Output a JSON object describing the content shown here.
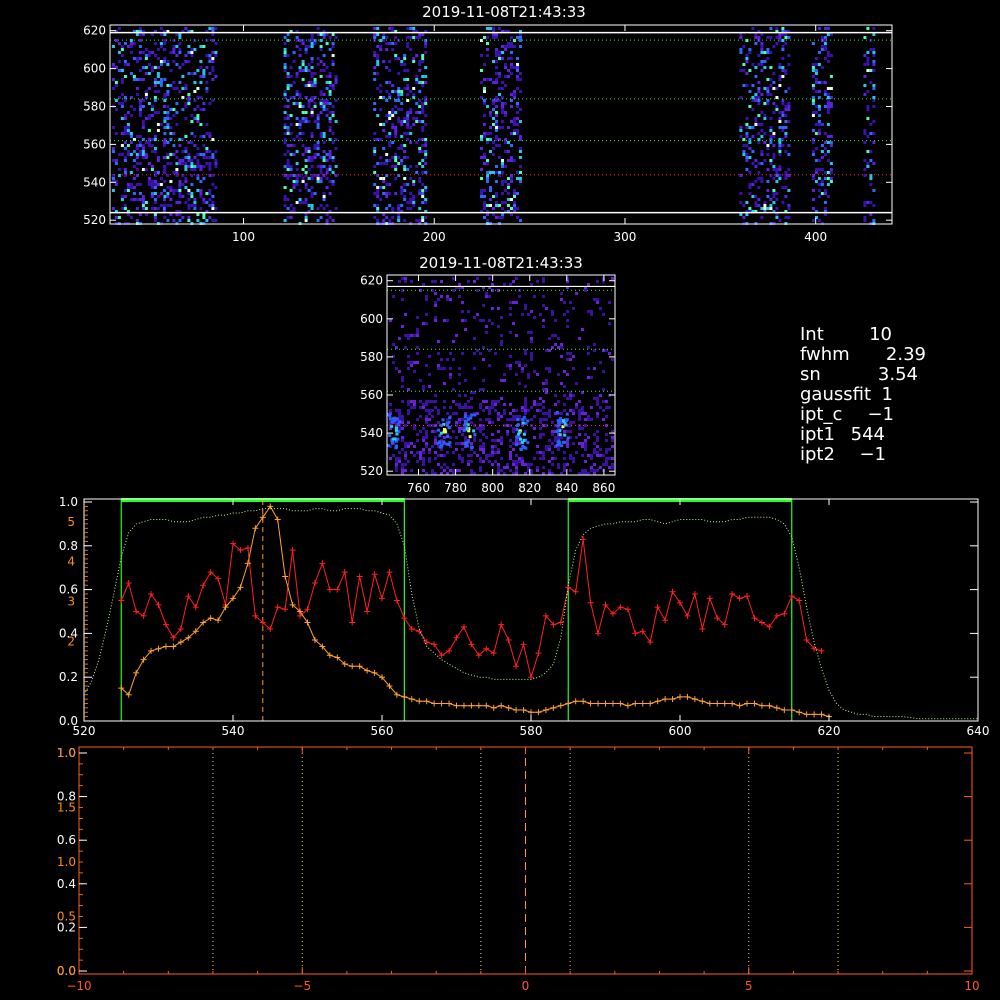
{
  "colors": {
    "background": "#000000",
    "axes_white": "#ffffff",
    "axes_orange": "#ff8c1a",
    "axes_red": "#ff2a2a",
    "green": "#22ff22",
    "dotted_green": "#b8ff9a",
    "dotted_gray": "#cfcfcf",
    "red_series": "#ff2020",
    "orange_series": "#ffa030",
    "orange_dash": "#ff9a2a",
    "orange_dotted": "#e8e070"
  },
  "info": {
    "int_label": "Int",
    "int_value": "10",
    "fwhm_label": "fwhm",
    "fwhm_value": "2.39",
    "sn_label": "sn",
    "sn_value": "3.54",
    "gaussfit_label": "gaussfit",
    "gaussfit_value": "1",
    "iptc_label": "ipt_c",
    "iptc_value": "−1",
    "ipt1_label": "ipt1",
    "ipt1_value": "544",
    "ipt2_label": "ipt2",
    "ipt2_value": "−1"
  },
  "chart_data": [
    {
      "type": "heatmap",
      "title": "2019-11-08T21:43:33",
      "xlim": [
        30,
        440
      ],
      "ylim": [
        518,
        623
      ],
      "xticks": [
        "100",
        "200",
        "300",
        "400"
      ],
      "xtick_values": [
        100,
        200,
        300,
        400
      ],
      "yticks": [
        "520",
        "540",
        "560",
        "580",
        "600",
        "620"
      ],
      "ytick_values": [
        520,
        540,
        560,
        580,
        600,
        620
      ],
      "white_lines_y": [
        524,
        619
      ],
      "green_dotted_y": [
        615,
        584,
        562
      ],
      "red_dotted_y": [
        544
      ],
      "bands_x": [
        [
          31,
          58
        ],
        [
          58,
          86
        ],
        [
          121,
          148
        ],
        [
          168,
          196
        ],
        [
          224,
          245
        ],
        [
          360,
          386
        ],
        [
          398,
          408
        ],
        [
          425,
          430
        ]
      ]
    },
    {
      "type": "heatmap",
      "title": "2019-11-08T21:43:33",
      "xlim": [
        743,
        866
      ],
      "ylim": [
        518,
        623
      ],
      "xticks": [
        "760",
        "780",
        "800",
        "820",
        "840",
        "860"
      ],
      "xtick_values": [
        760,
        780,
        800,
        820,
        840,
        860
      ],
      "yticks": [
        "520",
        "540",
        "560",
        "580",
        "600",
        "620"
      ],
      "ytick_values": [
        520,
        540,
        560,
        580,
        600,
        620
      ],
      "white_lines_y": [
        617
      ],
      "green_dotted_y": [
        615,
        584,
        562
      ],
      "red_dotted_y": [
        544
      ],
      "hot_spots": [
        {
          "x": 746,
          "y": 542
        },
        {
          "x": 773,
          "y": 542
        },
        {
          "x": 787,
          "y": 542
        },
        {
          "x": 815,
          "y": 541
        },
        {
          "x": 837,
          "y": 543
        }
      ]
    },
    {
      "type": "line",
      "xlim": [
        520,
        640
      ],
      "xticks": [
        "520",
        "540",
        "560",
        "580",
        "600",
        "620",
        "640"
      ],
      "xtick_values": [
        520,
        540,
        560,
        580,
        600,
        620,
        640
      ],
      "ylim_left_white": [
        0,
        1
      ],
      "yticks_left_white": [
        "0.0",
        "0.2",
        "0.4",
        "0.6",
        "0.8",
        "1.0"
      ],
      "ytick_values_left_white": [
        0,
        0.2,
        0.4,
        0.6,
        0.8,
        1.0
      ],
      "ylim_left_orange": [
        0,
        5.5
      ],
      "yticks_left_orange": [
        "2",
        "3",
        "4",
        "5"
      ],
      "ytick_values_left_orange": [
        2,
        3,
        4,
        5
      ],
      "green_windows": [
        [
          525,
          563
        ],
        [
          585,
          615
        ]
      ],
      "peak_marker_x": 544,
      "series": [
        {
          "color": "#ff2020",
          "x": [
            525,
            526,
            527,
            528,
            529,
            530,
            531,
            532,
            533,
            534,
            535,
            536,
            537,
            538,
            539,
            540,
            541,
            542,
            543,
            544,
            545,
            546,
            547,
            548,
            549,
            550,
            551,
            552,
            553,
            554,
            555,
            556,
            557,
            558,
            559,
            560,
            561,
            562,
            563,
            564,
            565,
            566,
            567,
            568,
            569,
            570,
            571,
            572,
            573,
            574,
            575,
            576,
            577,
            578,
            579,
            580,
            581,
            582,
            583,
            584,
            585,
            586,
            587,
            588,
            589,
            590,
            591,
            592,
            593,
            594,
            595,
            596,
            597,
            598,
            599,
            600,
            601,
            602,
            603,
            604,
            605,
            606,
            607,
            608,
            609,
            610,
            611,
            612,
            613,
            614,
            615,
            616,
            617,
            618,
            619
          ],
          "y": [
            0.55,
            0.63,
            0.5,
            0.48,
            0.58,
            0.53,
            0.44,
            0.38,
            0.42,
            0.57,
            0.52,
            0.62,
            0.68,
            0.65,
            0.53,
            0.81,
            0.78,
            0.79,
            0.48,
            0.45,
            0.42,
            0.52,
            0.51,
            0.78,
            0.48,
            0.51,
            0.63,
            0.72,
            0.6,
            0.6,
            0.68,
            0.45,
            0.66,
            0.5,
            0.67,
            0.56,
            0.68,
            0.55,
            0.47,
            0.42,
            0.41,
            0.36,
            0.35,
            0.3,
            0.32,
            0.38,
            0.43,
            0.35,
            0.3,
            0.33,
            0.31,
            0.44,
            0.37,
            0.25,
            0.35,
            0.2,
            0.31,
            0.48,
            0.44,
            0.45,
            0.61,
            0.59,
            0.83,
            0.54,
            0.4,
            0.53,
            0.49,
            0.52,
            0.51,
            0.4,
            0.41,
            0.36,
            0.52,
            0.46,
            0.59,
            0.54,
            0.48,
            0.58,
            0.42,
            0.56,
            0.47,
            0.44,
            0.58,
            0.56,
            0.57,
            0.47,
            0.45,
            0.43,
            0.48,
            0.49,
            0.57,
            0.55,
            0.37,
            0.33,
            0.32
          ]
        },
        {
          "color": "#ffa030",
          "x": [
            525,
            526,
            527,
            528,
            529,
            530,
            531,
            532,
            533,
            534,
            535,
            536,
            537,
            538,
            539,
            540,
            541,
            542,
            543,
            544,
            545,
            546,
            547,
            548,
            549,
            550,
            551,
            552,
            553,
            554,
            555,
            556,
            557,
            558,
            559,
            560,
            561,
            562,
            563,
            564,
            565,
            566,
            567,
            568,
            569,
            570,
            571,
            572,
            573,
            574,
            575,
            576,
            577,
            578,
            579,
            580,
            581,
            582,
            583,
            584,
            585,
            586,
            587,
            588,
            589,
            590,
            591,
            592,
            593,
            594,
            595,
            596,
            597,
            598,
            599,
            600,
            601,
            602,
            603,
            604,
            605,
            606,
            607,
            608,
            609,
            610,
            611,
            612,
            613,
            614,
            615,
            616,
            617,
            618,
            619,
            620
          ],
          "y": [
            0.15,
            0.12,
            0.22,
            0.28,
            0.32,
            0.33,
            0.34,
            0.34,
            0.36,
            0.38,
            0.41,
            0.45,
            0.47,
            0.46,
            0.52,
            0.56,
            0.61,
            0.72,
            0.88,
            0.93,
            0.98,
            0.92,
            0.66,
            0.53,
            0.5,
            0.45,
            0.37,
            0.34,
            0.3,
            0.29,
            0.26,
            0.25,
            0.25,
            0.23,
            0.22,
            0.2,
            0.16,
            0.12,
            0.11,
            0.1,
            0.09,
            0.09,
            0.08,
            0.08,
            0.08,
            0.07,
            0.07,
            0.07,
            0.07,
            0.07,
            0.06,
            0.07,
            0.06,
            0.05,
            0.05,
            0.04,
            0.04,
            0.05,
            0.06,
            0.07,
            0.08,
            0.09,
            0.09,
            0.08,
            0.08,
            0.08,
            0.08,
            0.08,
            0.07,
            0.08,
            0.08,
            0.08,
            0.09,
            0.1,
            0.1,
            0.11,
            0.11,
            0.1,
            0.09,
            0.08,
            0.08,
            0.08,
            0.08,
            0.07,
            0.08,
            0.08,
            0.07,
            0.07,
            0.06,
            0.05,
            0.05,
            0.04,
            0.03,
            0.03,
            0.03,
            0.02
          ]
        },
        {
          "color": "#b8ff9a",
          "style": "dotted",
          "x": [
            520,
            521,
            522,
            523,
            524,
            525,
            526,
            527,
            528,
            529,
            530,
            531,
            532,
            533,
            534,
            535,
            536,
            537,
            538,
            539,
            540,
            541,
            542,
            543,
            544,
            545,
            546,
            547,
            548,
            549,
            550,
            551,
            552,
            553,
            554,
            555,
            556,
            557,
            558,
            559,
            560,
            561,
            562,
            563,
            564,
            565,
            566,
            567,
            568,
            569,
            570,
            571,
            572,
            573,
            574,
            575,
            576,
            577,
            578,
            579,
            580,
            581,
            582,
            583,
            584,
            585,
            586,
            587,
            588,
            589,
            590,
            591,
            592,
            593,
            594,
            595,
            596,
            597,
            598,
            599,
            600,
            601,
            602,
            603,
            604,
            605,
            606,
            607,
            608,
            609,
            610,
            611,
            612,
            613,
            614,
            615,
            616,
            617,
            618,
            619,
            620,
            621,
            622,
            623,
            624,
            625,
            626,
            628,
            630,
            632,
            634,
            636,
            638,
            640
          ],
          "y": [
            0.12,
            0.18,
            0.28,
            0.42,
            0.58,
            0.75,
            0.86,
            0.9,
            0.91,
            0.92,
            0.92,
            0.92,
            0.91,
            0.91,
            0.91,
            0.92,
            0.93,
            0.93,
            0.94,
            0.94,
            0.95,
            0.95,
            0.96,
            0.96,
            0.97,
            0.97,
            0.97,
            0.97,
            0.96,
            0.96,
            0.96,
            0.97,
            0.97,
            0.96,
            0.96,
            0.97,
            0.97,
            0.97,
            0.96,
            0.96,
            0.95,
            0.94,
            0.9,
            0.8,
            0.58,
            0.42,
            0.34,
            0.31,
            0.28,
            0.26,
            0.24,
            0.22,
            0.21,
            0.2,
            0.2,
            0.19,
            0.19,
            0.19,
            0.19,
            0.19,
            0.19,
            0.2,
            0.22,
            0.26,
            0.38,
            0.62,
            0.78,
            0.85,
            0.88,
            0.89,
            0.9,
            0.9,
            0.91,
            0.91,
            0.91,
            0.92,
            0.92,
            0.91,
            0.9,
            0.91,
            0.92,
            0.92,
            0.92,
            0.92,
            0.91,
            0.91,
            0.91,
            0.92,
            0.92,
            0.93,
            0.93,
            0.93,
            0.93,
            0.92,
            0.9,
            0.84,
            0.7,
            0.52,
            0.36,
            0.24,
            0.14,
            0.08,
            0.05,
            0.04,
            0.03,
            0.03,
            0.02,
            0.02,
            0.02,
            0.01,
            0.01,
            0.01,
            0.01,
            0.01
          ]
        }
      ]
    },
    {
      "type": "line",
      "xlim": [
        -10,
        10
      ],
      "xticks": [
        "−10",
        "−5",
        "0",
        "5",
        "10"
      ],
      "xtick_values": [
        -10,
        -5,
        0,
        5,
        10
      ],
      "yticks_white": [
        "0.0",
        "0.2",
        "0.4",
        "0.6",
        "0.8",
        "1.0"
      ],
      "ytick_values_white": [
        0,
        0.2,
        0.4,
        0.6,
        0.8,
        1.0
      ],
      "yticks_orange": [
        "0.0",
        "0.5",
        "1.0",
        "1.5",
        "1.0"
      ],
      "ytick_values_orange": [
        0,
        0.5,
        1.0,
        1.5,
        2.0
      ],
      "dotted_gray_x": [
        -1,
        1
      ],
      "dotted_orange_x": [
        -7,
        -5,
        5,
        7
      ],
      "dashed_orange_x": [
        0
      ],
      "series": []
    }
  ]
}
